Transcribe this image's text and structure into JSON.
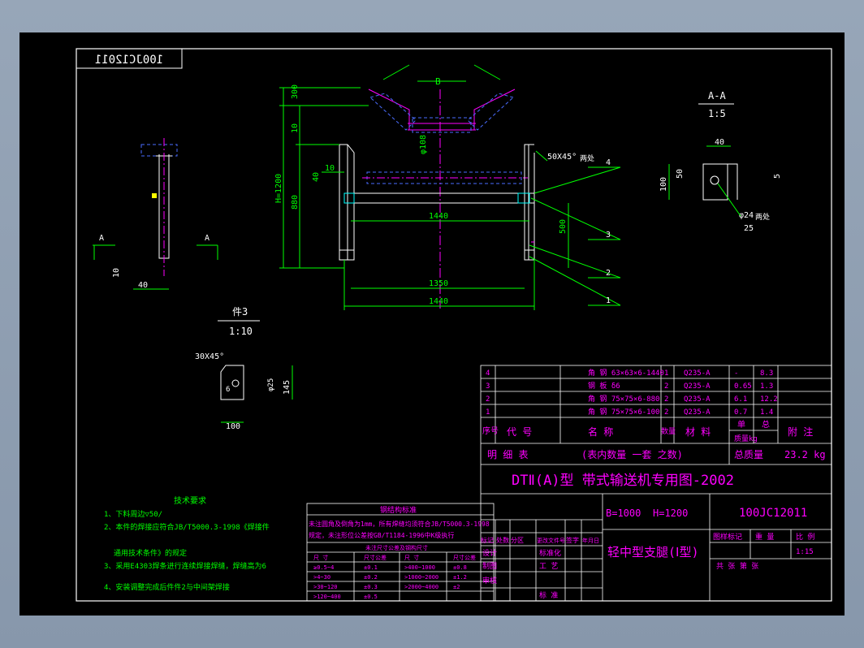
{
  "drawing_number_mirrored": "100JC12011",
  "section_label": "A-A",
  "section_scale": "1:5",
  "part3_label": "件3",
  "part3_scale": "1:10",
  "dims": {
    "b": "B",
    "h300": "300",
    "h10": "10",
    "h_total": "H=1200",
    "h880": "880",
    "d40": "40",
    "d10": "10",
    "phi108": "φ108",
    "chamfer_right": "50X45°",
    "weld_right": "两处",
    "l1440_top": "1440",
    "h500": "500",
    "l1350": "1350",
    "l1440_bot": "1440",
    "leader4": "4",
    "leader3": "3",
    "leader2": "2",
    "leader1": "1",
    "side_a_left": "A",
    "side_a_right": "A",
    "side_10": "10",
    "side_40": "40",
    "aa_40": "40",
    "aa_50": "50",
    "aa_100": "100",
    "aa_5": "5",
    "aa_phi24": "φ24",
    "aa_weld": "两处",
    "aa_25": "25",
    "p3_chamfer": "30X45°",
    "p3_6": "6",
    "p3_phi25": "φ25",
    "p3_145": "145",
    "p3_100": "100"
  },
  "tech_requirements": {
    "title": "技术要求",
    "lines": [
      "1、下料周边▽50/",
      "2、本件的焊接应符合JB/T5000.3-1998《焊接件",
      "通用技术条件》的规定",
      "3、采用E4303焊条进行连续焊接焊缝，焊缝高为6",
      "4、安装调整完成后件件2与中间架焊接"
    ]
  },
  "weld_standard": {
    "title": "钢结构标准",
    "note1": "未注圆角及倒角为1mm，所有焊缝均须符合JB/T5000.3-1998",
    "note2": "规定，未注形位公差按GB/T1184-1996中K级执行",
    "sub_title": "未注尺寸公差及钢构尺寸",
    "headers": [
      "尺 寸",
      "尺寸公差",
      "尺 寸",
      "尺寸公差"
    ],
    "rows": [
      [
        "≥0.5~4",
        "±0.1",
        ">400~1000",
        "±0.8"
      ],
      [
        ">4~30",
        "±0.2",
        ">1000~2000",
        "±1.2"
      ],
      [
        ">30~120",
        "±0.3",
        ">2000~4000",
        "±2"
      ],
      [
        ">120~400",
        "±0.5",
        "",
        ""
      ]
    ]
  },
  "bom": {
    "rows": [
      {
        "no": "4",
        "code": "",
        "name": "角 钢 63×63×6-1440",
        "qty": "1",
        "material": "Q235-A",
        "unit": "-",
        "total": "8.3"
      },
      {
        "no": "3",
        "code": "",
        "name": "钢 板 δ6",
        "qty": "2",
        "material": "Q235-A",
        "unit": "0.65",
        "total": "1.3"
      },
      {
        "no": "2",
        "code": "",
        "name": "角 钢 75×75×6-880",
        "qty": "2",
        "material": "Q235-A",
        "unit": "6.1",
        "total": "12.2"
      },
      {
        "no": "1",
        "code": "",
        "name": "角 钢 75×75×6-100",
        "qty": "2",
        "material": "Q235-A",
        "unit": "0.7",
        "total": "1.4"
      }
    ],
    "header": {
      "no": "序号",
      "code": "代 号",
      "name": "名 称",
      "qty": "数量",
      "material": "材 料",
      "unit_top": "单",
      "total_top": "总",
      "mass": "质量kg",
      "note": "附 注"
    },
    "detail_label": "明 细 表",
    "detail_note": "(表内数量 一套 之数)",
    "total_mass_label": "总质量",
    "total_mass_value": "23.2 kg"
  },
  "title_block": {
    "banner": "DTⅡ(A)型 带式输送机专用图-2002",
    "b_param": "B=1000",
    "h_param": "H=1200",
    "drawing_number": "100JC12011",
    "part_name": "轻中型支腿(Ⅰ型)",
    "rev_headers": [
      "标记",
      "处数",
      "分区",
      "更改文件号",
      "签字",
      "年月日"
    ],
    "design": "设计",
    "draw": "制图",
    "review": "审核",
    "standardize": "标准化",
    "process": "工 艺",
    "approve": "标 准",
    "stage": "图样标记",
    "weight": "重 量",
    "scale_label": "比 例",
    "scale_value": "1:15",
    "sheets": "共   张   第   张"
  }
}
